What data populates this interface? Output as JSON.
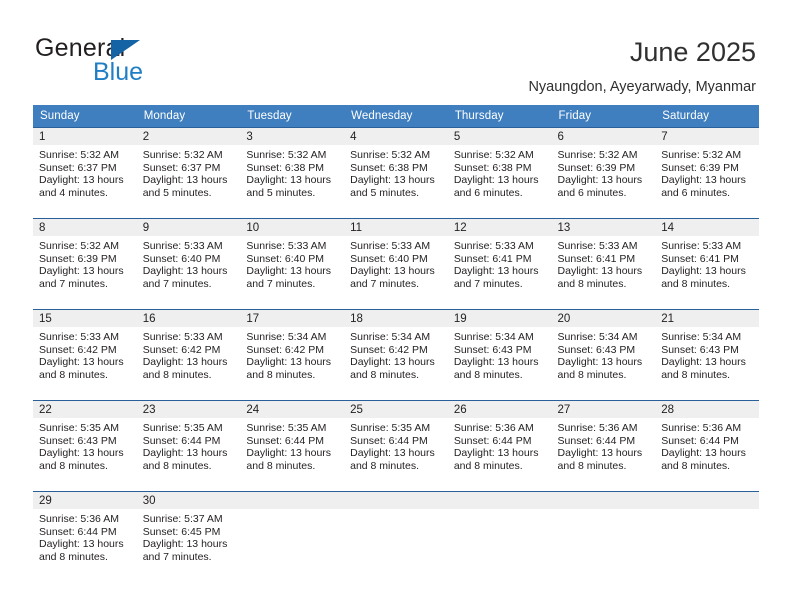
{
  "brand": {
    "name_part1": "General",
    "name_part2": "Blue",
    "accent_color": "#1f7ec4",
    "triangle_color": "#1464a5"
  },
  "header": {
    "title": "June 2025",
    "subtitle": "Nyaungdon, Ayeyarwady, Myanmar"
  },
  "calendar": {
    "header_bg": "#3f7fbf",
    "row_divider_color": "#2a6099",
    "daynum_band_bg": "#efefef",
    "weekday_headers": [
      "Sunday",
      "Monday",
      "Tuesday",
      "Wednesday",
      "Thursday",
      "Friday",
      "Saturday"
    ],
    "weeks": [
      [
        {
          "day": "1",
          "sunrise": "Sunrise: 5:32 AM",
          "sunset": "Sunset: 6:37 PM",
          "daylight_line1": "Daylight: 13 hours",
          "daylight_line2": "and 4 minutes."
        },
        {
          "day": "2",
          "sunrise": "Sunrise: 5:32 AM",
          "sunset": "Sunset: 6:37 PM",
          "daylight_line1": "Daylight: 13 hours",
          "daylight_line2": "and 5 minutes."
        },
        {
          "day": "3",
          "sunrise": "Sunrise: 5:32 AM",
          "sunset": "Sunset: 6:38 PM",
          "daylight_line1": "Daylight: 13 hours",
          "daylight_line2": "and 5 minutes."
        },
        {
          "day": "4",
          "sunrise": "Sunrise: 5:32 AM",
          "sunset": "Sunset: 6:38 PM",
          "daylight_line1": "Daylight: 13 hours",
          "daylight_line2": "and 5 minutes."
        },
        {
          "day": "5",
          "sunrise": "Sunrise: 5:32 AM",
          "sunset": "Sunset: 6:38 PM",
          "daylight_line1": "Daylight: 13 hours",
          "daylight_line2": "and 6 minutes."
        },
        {
          "day": "6",
          "sunrise": "Sunrise: 5:32 AM",
          "sunset": "Sunset: 6:39 PM",
          "daylight_line1": "Daylight: 13 hours",
          "daylight_line2": "and 6 minutes."
        },
        {
          "day": "7",
          "sunrise": "Sunrise: 5:32 AM",
          "sunset": "Sunset: 6:39 PM",
          "daylight_line1": "Daylight: 13 hours",
          "daylight_line2": "and 6 minutes."
        }
      ],
      [
        {
          "day": "8",
          "sunrise": "Sunrise: 5:32 AM",
          "sunset": "Sunset: 6:39 PM",
          "daylight_line1": "Daylight: 13 hours",
          "daylight_line2": "and 7 minutes."
        },
        {
          "day": "9",
          "sunrise": "Sunrise: 5:33 AM",
          "sunset": "Sunset: 6:40 PM",
          "daylight_line1": "Daylight: 13 hours",
          "daylight_line2": "and 7 minutes."
        },
        {
          "day": "10",
          "sunrise": "Sunrise: 5:33 AM",
          "sunset": "Sunset: 6:40 PM",
          "daylight_line1": "Daylight: 13 hours",
          "daylight_line2": "and 7 minutes."
        },
        {
          "day": "11",
          "sunrise": "Sunrise: 5:33 AM",
          "sunset": "Sunset: 6:40 PM",
          "daylight_line1": "Daylight: 13 hours",
          "daylight_line2": "and 7 minutes."
        },
        {
          "day": "12",
          "sunrise": "Sunrise: 5:33 AM",
          "sunset": "Sunset: 6:41 PM",
          "daylight_line1": "Daylight: 13 hours",
          "daylight_line2": "and 7 minutes."
        },
        {
          "day": "13",
          "sunrise": "Sunrise: 5:33 AM",
          "sunset": "Sunset: 6:41 PM",
          "daylight_line1": "Daylight: 13 hours",
          "daylight_line2": "and 8 minutes."
        },
        {
          "day": "14",
          "sunrise": "Sunrise: 5:33 AM",
          "sunset": "Sunset: 6:41 PM",
          "daylight_line1": "Daylight: 13 hours",
          "daylight_line2": "and 8 minutes."
        }
      ],
      [
        {
          "day": "15",
          "sunrise": "Sunrise: 5:33 AM",
          "sunset": "Sunset: 6:42 PM",
          "daylight_line1": "Daylight: 13 hours",
          "daylight_line2": "and 8 minutes."
        },
        {
          "day": "16",
          "sunrise": "Sunrise: 5:33 AM",
          "sunset": "Sunset: 6:42 PM",
          "daylight_line1": "Daylight: 13 hours",
          "daylight_line2": "and 8 minutes."
        },
        {
          "day": "17",
          "sunrise": "Sunrise: 5:34 AM",
          "sunset": "Sunset: 6:42 PM",
          "daylight_line1": "Daylight: 13 hours",
          "daylight_line2": "and 8 minutes."
        },
        {
          "day": "18",
          "sunrise": "Sunrise: 5:34 AM",
          "sunset": "Sunset: 6:42 PM",
          "daylight_line1": "Daylight: 13 hours",
          "daylight_line2": "and 8 minutes."
        },
        {
          "day": "19",
          "sunrise": "Sunrise: 5:34 AM",
          "sunset": "Sunset: 6:43 PM",
          "daylight_line1": "Daylight: 13 hours",
          "daylight_line2": "and 8 minutes."
        },
        {
          "day": "20",
          "sunrise": "Sunrise: 5:34 AM",
          "sunset": "Sunset: 6:43 PM",
          "daylight_line1": "Daylight: 13 hours",
          "daylight_line2": "and 8 minutes."
        },
        {
          "day": "21",
          "sunrise": "Sunrise: 5:34 AM",
          "sunset": "Sunset: 6:43 PM",
          "daylight_line1": "Daylight: 13 hours",
          "daylight_line2": "and 8 minutes."
        }
      ],
      [
        {
          "day": "22",
          "sunrise": "Sunrise: 5:35 AM",
          "sunset": "Sunset: 6:43 PM",
          "daylight_line1": "Daylight: 13 hours",
          "daylight_line2": "and 8 minutes."
        },
        {
          "day": "23",
          "sunrise": "Sunrise: 5:35 AM",
          "sunset": "Sunset: 6:44 PM",
          "daylight_line1": "Daylight: 13 hours",
          "daylight_line2": "and 8 minutes."
        },
        {
          "day": "24",
          "sunrise": "Sunrise: 5:35 AM",
          "sunset": "Sunset: 6:44 PM",
          "daylight_line1": "Daylight: 13 hours",
          "daylight_line2": "and 8 minutes."
        },
        {
          "day": "25",
          "sunrise": "Sunrise: 5:35 AM",
          "sunset": "Sunset: 6:44 PM",
          "daylight_line1": "Daylight: 13 hours",
          "daylight_line2": "and 8 minutes."
        },
        {
          "day": "26",
          "sunrise": "Sunrise: 5:36 AM",
          "sunset": "Sunset: 6:44 PM",
          "daylight_line1": "Daylight: 13 hours",
          "daylight_line2": "and 8 minutes."
        },
        {
          "day": "27",
          "sunrise": "Sunrise: 5:36 AM",
          "sunset": "Sunset: 6:44 PM",
          "daylight_line1": "Daylight: 13 hours",
          "daylight_line2": "and 8 minutes."
        },
        {
          "day": "28",
          "sunrise": "Sunrise: 5:36 AM",
          "sunset": "Sunset: 6:44 PM",
          "daylight_line1": "Daylight: 13 hours",
          "daylight_line2": "and 8 minutes."
        }
      ],
      [
        {
          "day": "29",
          "sunrise": "Sunrise: 5:36 AM",
          "sunset": "Sunset: 6:44 PM",
          "daylight_line1": "Daylight: 13 hours",
          "daylight_line2": "and 8 minutes."
        },
        {
          "day": "30",
          "sunrise": "Sunrise: 5:37 AM",
          "sunset": "Sunset: 6:45 PM",
          "daylight_line1": "Daylight: 13 hours",
          "daylight_line2": "and 7 minutes."
        },
        {
          "day": "",
          "sunrise": "",
          "sunset": "",
          "daylight_line1": "",
          "daylight_line2": ""
        },
        {
          "day": "",
          "sunrise": "",
          "sunset": "",
          "daylight_line1": "",
          "daylight_line2": ""
        },
        {
          "day": "",
          "sunrise": "",
          "sunset": "",
          "daylight_line1": "",
          "daylight_line2": ""
        },
        {
          "day": "",
          "sunrise": "",
          "sunset": "",
          "daylight_line1": "",
          "daylight_line2": ""
        },
        {
          "day": "",
          "sunrise": "",
          "sunset": "",
          "daylight_line1": "",
          "daylight_line2": ""
        }
      ]
    ]
  }
}
